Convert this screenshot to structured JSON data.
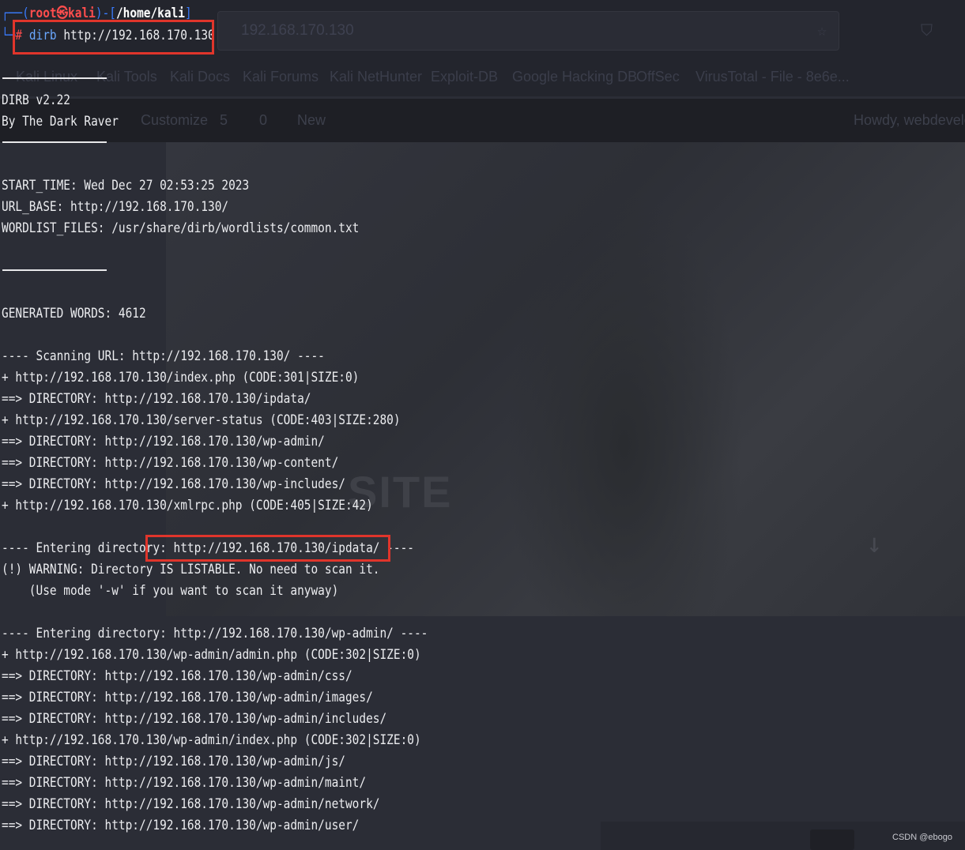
{
  "background": {
    "url_text": "192.168.170.130",
    "bookmarks": [
      "Kali Linux",
      "Kali Tools",
      "Kali Docs",
      "Kali Forums",
      "Kali NetHunter",
      "Exploit-DB",
      "Google Hacking DB",
      "OffSec",
      "VirusTotal - File - 8e6e..."
    ],
    "wp_customize": "Customize",
    "wp_updates": "5",
    "wp_comments": "0",
    "wp_new": "New",
    "wp_howdy": "Howdy, webdeveloper",
    "hero_text": "SITE"
  },
  "terminal": {
    "prompt_user": "root㉿kali",
    "prompt_path": "/home/kali",
    "prompt_hash": "#",
    "command": "dirb",
    "command_arg": "http://192.168.170.130",
    "lines": [
      "DIRB v2.22",
      "By The Dark Raver",
      "START_TIME: Wed Dec 27 02:53:25 2023",
      "URL_BASE: http://192.168.170.130/",
      "WORDLIST_FILES: /usr/share/dirb/wordlists/common.txt",
      "GENERATED WORDS: 4612",
      "---- Scanning URL: http://192.168.170.130/ ----",
      "+ http://192.168.170.130/index.php (CODE:301|SIZE:0)",
      "==> DIRECTORY: http://192.168.170.130/ipdata/",
      "+ http://192.168.170.130/server-status (CODE:403|SIZE:280)",
      "==> DIRECTORY: http://192.168.170.130/wp-admin/",
      "==> DIRECTORY: http://192.168.170.130/wp-content/",
      "==> DIRECTORY: http://192.168.170.130/wp-includes/",
      "+ http://192.168.170.130/xmlrpc.php (CODE:405|SIZE:42)",
      "---- Entering directory: http://192.168.170.130/ipdata/ ----",
      "(!) WARNING: Directory IS LISTABLE. No need to scan it.",
      "    (Use mode '-w' if you want to scan it anyway)",
      "---- Entering directory: http://192.168.170.130/wp-admin/ ----",
      "+ http://192.168.170.130/wp-admin/admin.php (CODE:302|SIZE:0)",
      "==> DIRECTORY: http://192.168.170.130/wp-admin/css/",
      "==> DIRECTORY: http://192.168.170.130/wp-admin/images/",
      "==> DIRECTORY: http://192.168.170.130/wp-admin/includes/",
      "+ http://192.168.170.130/wp-admin/index.php (CODE:302|SIZE:0)",
      "==> DIRECTORY: http://192.168.170.130/wp-admin/js/",
      "==> DIRECTORY: http://192.168.170.130/wp-admin/maint/",
      "==> DIRECTORY: http://192.168.170.130/wp-admin/network/",
      "==> DIRECTORY: http://192.168.170.130/wp-admin/user/"
    ]
  },
  "watermark": "CSDN @ebogo"
}
